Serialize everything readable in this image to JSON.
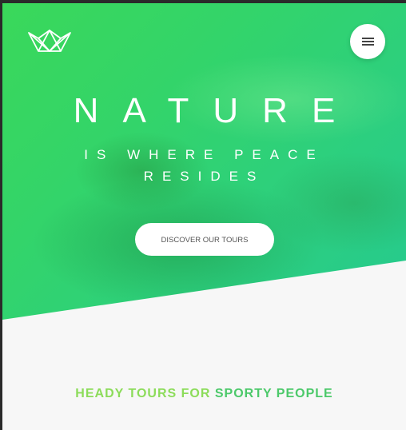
{
  "header": {
    "logo_icon": "crown-icon",
    "menu_icon": "hamburger-menu-icon"
  },
  "hero": {
    "title": "NATURE",
    "subtitle": "IS WHERE PEACE RESIDES",
    "cta_label": "DISCOVER OUR TOURS"
  },
  "section": {
    "heading_part1": "HEADY TOURS FOR ",
    "heading_part2": "SPORTY PEOPLE"
  },
  "colors": {
    "hero_gradient_start": "#3ad85a",
    "hero_gradient_end": "#25c98f",
    "heading_light_green": "#8cdc5a",
    "heading_green": "#4cc96a",
    "background": "#f7f7f7"
  }
}
